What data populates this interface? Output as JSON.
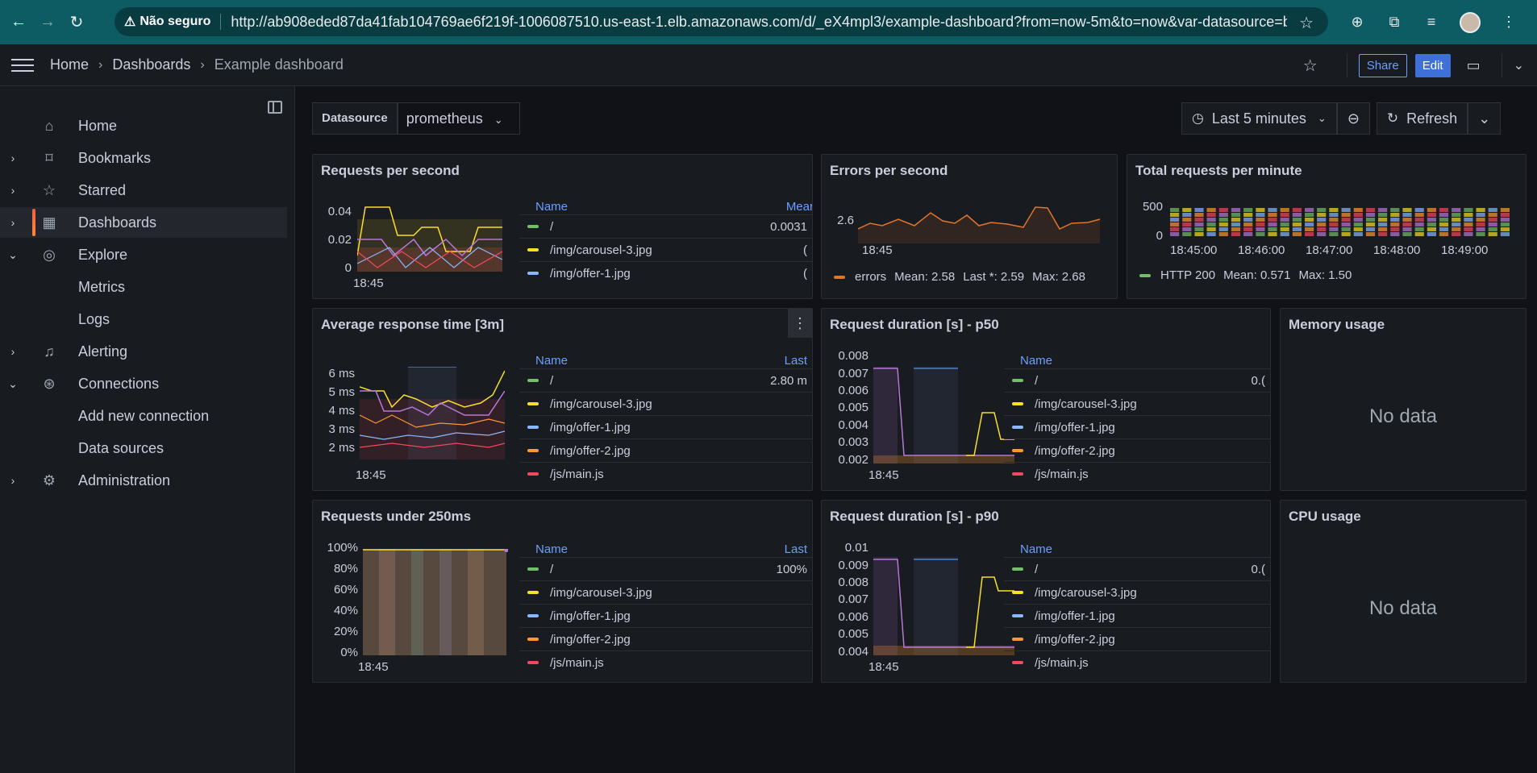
{
  "browser": {
    "insecure_label": "Não seguro",
    "url": "http://ab908eded87da41fab104769ae6f219f-1006087510.us-east-1.elb.amazonaws.com/d/_eX4mpl3/example-dashboard?from=now-5m&to=now&var-datasource=be..."
  },
  "breadcrumb": {
    "home": "Home",
    "dashboards": "Dashboards",
    "current": "Example dashboard"
  },
  "toolbar": {
    "share": "Share",
    "edit": "Edit"
  },
  "sidebar": {
    "items": [
      {
        "label": "Home",
        "icon": "home-icon",
        "expand": ""
      },
      {
        "label": "Bookmarks",
        "icon": "bookmark-icon",
        "expand": "›"
      },
      {
        "label": "Starred",
        "icon": "star-icon",
        "expand": "›"
      },
      {
        "label": "Dashboards",
        "icon": "dashboards-icon",
        "expand": "›"
      },
      {
        "label": "Explore",
        "icon": "compass-icon",
        "expand": "⌄"
      },
      {
        "label": "Metrics",
        "icon": "",
        "expand": ""
      },
      {
        "label": "Logs",
        "icon": "",
        "expand": ""
      },
      {
        "label": "Alerting",
        "icon": "bell-icon",
        "expand": "›"
      },
      {
        "label": "Connections",
        "icon": "connections-icon",
        "expand": "⌄"
      },
      {
        "label": "Add new connection",
        "icon": "",
        "expand": ""
      },
      {
        "label": "Data sources",
        "icon": "",
        "expand": ""
      },
      {
        "label": "Administration",
        "icon": "gear-icon",
        "expand": "›"
      }
    ]
  },
  "variables": {
    "datasource_label": "Datasource",
    "datasource_value": "prometheus"
  },
  "time_picker": {
    "range": "Last 5 minutes",
    "refresh": "Refresh"
  },
  "colors": {
    "green": "#73bf69",
    "yellow": "#fade2a",
    "blue": "#8ab8ff",
    "orange": "#ff9830",
    "red": "#f2495c",
    "purple": "#b877d9",
    "errors": "#e0752d"
  },
  "panels": {
    "rps": {
      "title": "Requests per second",
      "y_ticks": [
        "0.04",
        "0.02",
        "0"
      ],
      "x_tick": "18:45",
      "legend_header": {
        "name": "Name",
        "stat": "Mear"
      },
      "rows": [
        {
          "name": "/",
          "value": "0.0031",
          "color": "#73bf69"
        },
        {
          "name": "/img/carousel-3.jpg",
          "value": "(",
          "color": "#fade2a"
        },
        {
          "name": "/img/offer-1.jpg",
          "value": "(",
          "color": "#8ab8ff"
        }
      ]
    },
    "eps": {
      "title": "Errors per second",
      "y_tick": "2.6",
      "x_tick": "18:45",
      "legend": {
        "name": "errors",
        "mean": "Mean: 2.58",
        "last": "Last *: 2.59",
        "max": "Max: 2.68"
      }
    },
    "rpm": {
      "title": "Total requests per minute",
      "y_ticks": [
        "500",
        "0"
      ],
      "x_ticks": [
        "18:45:00",
        "18:46:00",
        "18:47:00",
        "18:48:00",
        "18:49:00"
      ],
      "legend": {
        "name": "HTTP 200",
        "mean": "Mean: 0.571",
        "max": "Max: 1.50"
      }
    },
    "art": {
      "title": "Average response time [3m]",
      "menu": "⋮",
      "y_ticks": [
        "6 ms",
        "5 ms",
        "4 ms",
        "3 ms",
        "2 ms"
      ],
      "x_tick": "18:45",
      "legend_header": {
        "name": "Name",
        "stat": "Last"
      },
      "rows": [
        {
          "name": "/",
          "value": "2.80 m",
          "color": "#73bf69"
        },
        {
          "name": "/img/carousel-3.jpg",
          "value": "",
          "color": "#fade2a"
        },
        {
          "name": "/img/offer-1.jpg",
          "value": "",
          "color": "#8ab8ff"
        },
        {
          "name": "/img/offer-2.jpg",
          "value": "",
          "color": "#ff9830"
        },
        {
          "name": "/js/main.js",
          "value": "",
          "color": "#f2495c"
        }
      ]
    },
    "p50": {
      "title": "Request duration [s] - p50",
      "y_ticks": [
        "0.008",
        "0.007",
        "0.006",
        "0.005",
        "0.004",
        "0.003",
        "0.002"
      ],
      "x_tick": "18:45",
      "legend_header": {
        "name": "Name"
      },
      "rows": [
        {
          "name": "/",
          "value": "0.(",
          "color": "#73bf69"
        },
        {
          "name": "/img/carousel-3.jpg",
          "value": "",
          "color": "#fade2a"
        },
        {
          "name": "/img/offer-1.jpg",
          "value": "",
          "color": "#8ab8ff"
        },
        {
          "name": "/img/offer-2.jpg",
          "value": "",
          "color": "#ff9830"
        },
        {
          "name": "/js/main.js",
          "value": "",
          "color": "#f2495c"
        }
      ]
    },
    "mem": {
      "title": "Memory usage",
      "nodata": "No data"
    },
    "r250": {
      "title": "Requests under 250ms",
      "y_ticks": [
        "100%",
        "80%",
        "60%",
        "40%",
        "20%",
        "0%"
      ],
      "x_tick": "18:45",
      "legend_header": {
        "name": "Name",
        "stat": "Last"
      },
      "rows": [
        {
          "name": "/",
          "value": "100%",
          "color": "#73bf69"
        },
        {
          "name": "/img/carousel-3.jpg",
          "value": "",
          "color": "#fade2a"
        },
        {
          "name": "/img/offer-1.jpg",
          "value": "",
          "color": "#8ab8ff"
        },
        {
          "name": "/img/offer-2.jpg",
          "value": "",
          "color": "#ff9830"
        },
        {
          "name": "/js/main.js",
          "value": "",
          "color": "#f2495c"
        }
      ]
    },
    "p90": {
      "title": "Request duration [s] - p90",
      "y_ticks": [
        "0.01",
        "0.009",
        "0.008",
        "0.007",
        "0.006",
        "0.005",
        "0.004"
      ],
      "x_tick": "18:45",
      "legend_header": {
        "name": "Name"
      },
      "rows": [
        {
          "name": "/",
          "value": "0.(",
          "color": "#73bf69"
        },
        {
          "name": "/img/carousel-3.jpg",
          "value": "",
          "color": "#fade2a"
        },
        {
          "name": "/img/offer-1.jpg",
          "value": "",
          "color": "#8ab8ff"
        },
        {
          "name": "/img/offer-2.jpg",
          "value": "",
          "color": "#ff9830"
        },
        {
          "name": "/js/main.js",
          "value": "",
          "color": "#f2495c"
        }
      ]
    },
    "cpu": {
      "title": "CPU usage",
      "nodata": "No data"
    }
  }
}
